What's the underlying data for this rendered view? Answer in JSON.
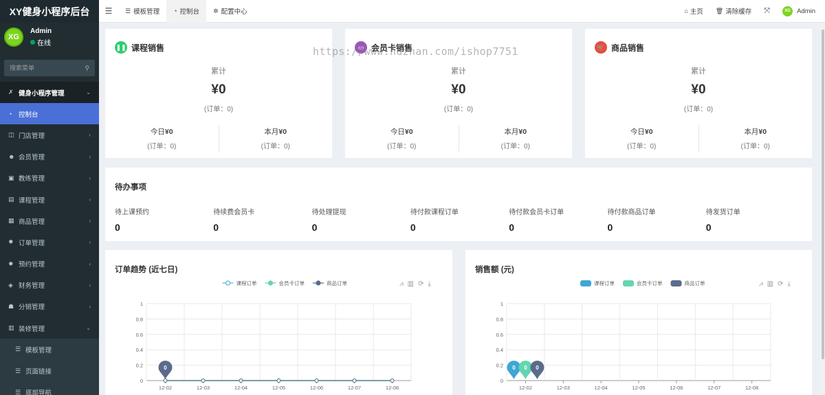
{
  "app": {
    "brand": "XY健身小程序后台",
    "user": {
      "name": "Admin",
      "status": "在线",
      "avatar_text": "XG"
    },
    "search_placeholder": "搜索菜单"
  },
  "sidebar": {
    "items": [
      {
        "label": "健身小程序管理",
        "icon": "dumbbell-icon",
        "glyph": "✗",
        "type": "header",
        "caret": "⌄"
      },
      {
        "label": "控制台",
        "icon": "dashboard-icon",
        "glyph": "◔",
        "type": "active",
        "caret": ""
      },
      {
        "label": "门店管理",
        "icon": "store-icon",
        "glyph": "◫",
        "type": "normal",
        "caret": "‹"
      },
      {
        "label": "会员管理",
        "icon": "user-icon",
        "glyph": "☻",
        "type": "normal",
        "caret": "‹"
      },
      {
        "label": "教练管理",
        "icon": "coach-icon",
        "glyph": "▣",
        "type": "normal",
        "caret": "‹"
      },
      {
        "label": "课程管理",
        "icon": "course-icon",
        "glyph": "▤",
        "type": "normal",
        "caret": "‹"
      },
      {
        "label": "商品管理",
        "icon": "goods-icon",
        "glyph": "▦",
        "type": "normal",
        "caret": "‹"
      },
      {
        "label": "订单管理",
        "icon": "order-icon",
        "glyph": "✹",
        "type": "normal",
        "caret": "‹"
      },
      {
        "label": "预约管理",
        "icon": "reservation-icon",
        "glyph": "✹",
        "type": "normal",
        "caret": "‹"
      },
      {
        "label": "财务管理",
        "icon": "finance-icon",
        "glyph": "◈",
        "type": "normal",
        "caret": "‹"
      },
      {
        "label": "分销管理",
        "icon": "distribution-icon",
        "glyph": "☗",
        "type": "normal",
        "caret": "‹"
      },
      {
        "label": "装修管理",
        "icon": "decoration-icon",
        "glyph": "▥",
        "type": "normal",
        "caret": "⌄"
      },
      {
        "label": "模板管理",
        "icon": "list-icon",
        "glyph": "☰",
        "type": "sub",
        "caret": ""
      },
      {
        "label": "页面链接",
        "icon": "list-icon",
        "glyph": "☰",
        "type": "sub",
        "caret": ""
      },
      {
        "label": "底部导航",
        "icon": "list-icon",
        "glyph": "☰",
        "type": "sub",
        "caret": ""
      }
    ]
  },
  "topbar": {
    "tabs": [
      {
        "label": "模板管理",
        "icon": "list-icon",
        "glyph": "☰"
      },
      {
        "label": "控制台",
        "icon": "dashboard-icon",
        "glyph": "◔"
      },
      {
        "label": "配置中心",
        "icon": "gear-icon",
        "glyph": "✲"
      }
    ],
    "active_tab": 1,
    "right": {
      "home": "主页",
      "clear_cache": "清除缓存",
      "user": "Admin"
    }
  },
  "watermark": "https://www.huzhan.com/ishop7751",
  "sales": [
    {
      "title": "课程销售",
      "icon": "book-icon",
      "glyph": "❚❚",
      "color": "#2ecc71",
      "total_label": "累计",
      "total": "¥0",
      "total_orders": "(订单：0)",
      "today_label": "今日",
      "today": "¥0",
      "today_orders": "(订单：0)",
      "month_label": "本月",
      "month": "¥0",
      "month_orders": "(订单：0)"
    },
    {
      "title": "会员卡销售",
      "icon": "card-icon",
      "glyph": "▭",
      "color": "#9b59b6",
      "total_label": "累计",
      "total": "¥0",
      "total_orders": "(订单：0)",
      "today_label": "今日",
      "today": "¥0",
      "today_orders": "(订单：0)",
      "month_label": "本月",
      "month": "¥0",
      "month_orders": "(订单：0)"
    },
    {
      "title": "商品销售",
      "icon": "cart-icon",
      "glyph": "🛒",
      "color": "#e74c3c",
      "total_label": "累计",
      "total": "¥0",
      "total_orders": "(订单：0)",
      "today_label": "今日",
      "today": "¥0",
      "today_orders": "(订单：0)",
      "month_label": "本月",
      "month": "¥0",
      "month_orders": "(订单：0)"
    }
  ],
  "todo": {
    "title": "待办事项",
    "items": [
      {
        "label": "待上课预约",
        "value": "0"
      },
      {
        "label": "待续费会员卡",
        "value": "0"
      },
      {
        "label": "待处理提现",
        "value": "0"
      },
      {
        "label": "待付款课程订单",
        "value": "0"
      },
      {
        "label": "待付款会员卡订单",
        "value": "0"
      },
      {
        "label": "待付款商品订单",
        "value": "0"
      },
      {
        "label": "待发货订单",
        "value": "0"
      }
    ]
  },
  "chart_data": [
    {
      "type": "line",
      "title": "订单趋势 (近七日)",
      "x": [
        "12-02",
        "12-03",
        "12-04",
        "12-05",
        "12-06",
        "12-07",
        "12-08"
      ],
      "ylim": [
        0,
        1
      ],
      "yticks": [
        0,
        0.2,
        0.4,
        0.6,
        0.8,
        1
      ],
      "series": [
        {
          "name": "课程订单",
          "color": "#4fb6d6",
          "values": [
            0,
            0,
            0,
            0,
            0,
            0,
            0
          ]
        },
        {
          "name": "会员卡订单",
          "color": "#62d6b1",
          "values": [
            0,
            0,
            0,
            0,
            0,
            0,
            0
          ]
        },
        {
          "name": "商品订单",
          "color": "#5a6b8c",
          "values": [
            0,
            0,
            0,
            0,
            0,
            0,
            0
          ]
        }
      ],
      "markers": [
        {
          "series": 2,
          "index": 0,
          "label": "0"
        }
      ],
      "legend": "top-center",
      "grid": true
    },
    {
      "type": "bar",
      "title": "销售额 (元)",
      "categories": [
        "12-02",
        "12-03",
        "12-04",
        "12-05",
        "12-06",
        "12-07",
        "12-08"
      ],
      "ylim": [
        0,
        1
      ],
      "yticks": [
        0,
        0.2,
        0.4,
        0.6,
        0.8,
        1
      ],
      "series": [
        {
          "name": "课程订单",
          "color": "#3fa7d6",
          "values": [
            0,
            0,
            0,
            0,
            0,
            0,
            0
          ]
        },
        {
          "name": "会员卡订单",
          "color": "#62d6b1",
          "values": [
            0,
            0,
            0,
            0,
            0,
            0,
            0
          ]
        },
        {
          "name": "商品订单",
          "color": "#5a6b8c",
          "values": [
            0,
            0,
            0,
            0,
            0,
            0,
            0
          ]
        }
      ],
      "markers": [
        {
          "series": 0,
          "index": 0,
          "label": "0"
        },
        {
          "series": 1,
          "index": 0,
          "label": "0"
        },
        {
          "series": 2,
          "index": 0,
          "label": "0"
        }
      ],
      "legend": "top-center",
      "grid": true
    }
  ]
}
